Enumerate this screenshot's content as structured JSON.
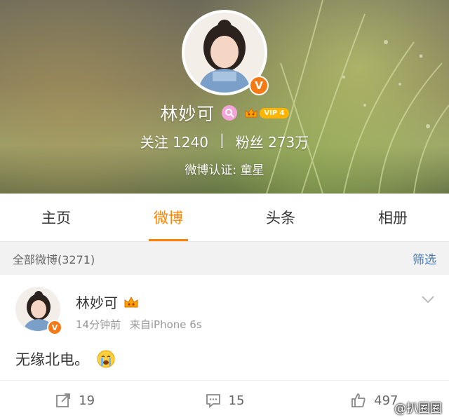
{
  "profile": {
    "name": "林妙可",
    "vip_label": "VIP 4",
    "following_label": "关注",
    "following_count": "1240",
    "separator": "|",
    "followers_label": "粉丝",
    "followers_count": "273万",
    "verification": "微博认证: 童星"
  },
  "tabs": [
    {
      "label": "主页",
      "active": false
    },
    {
      "label": "微博",
      "active": true
    },
    {
      "label": "头条",
      "active": false
    },
    {
      "label": "相册",
      "active": false
    }
  ],
  "filter": {
    "title": "全部微博(3271)",
    "button_label": "筛选"
  },
  "post": {
    "author": "林妙可",
    "time": "14分钟前",
    "source": "来自iPhone 6s",
    "text": "无缘北电。",
    "repost_count": "19",
    "comment_count": "15",
    "like_count": "497"
  },
  "watermark": "@扒圈圈",
  "colors": {
    "accent": "#ff8200",
    "link": "#4a7ab0",
    "verified": "#f57a16",
    "vip": "#ffb400"
  },
  "icons": {
    "verified": "verified-v-icon",
    "search": "search-badge-icon",
    "vip_crown": "crown-icon",
    "chevron": "chevron-down-icon",
    "repost": "repost-icon",
    "comment": "comment-icon",
    "like": "thumbs-up-icon",
    "emoji": "crying-face-icon"
  }
}
